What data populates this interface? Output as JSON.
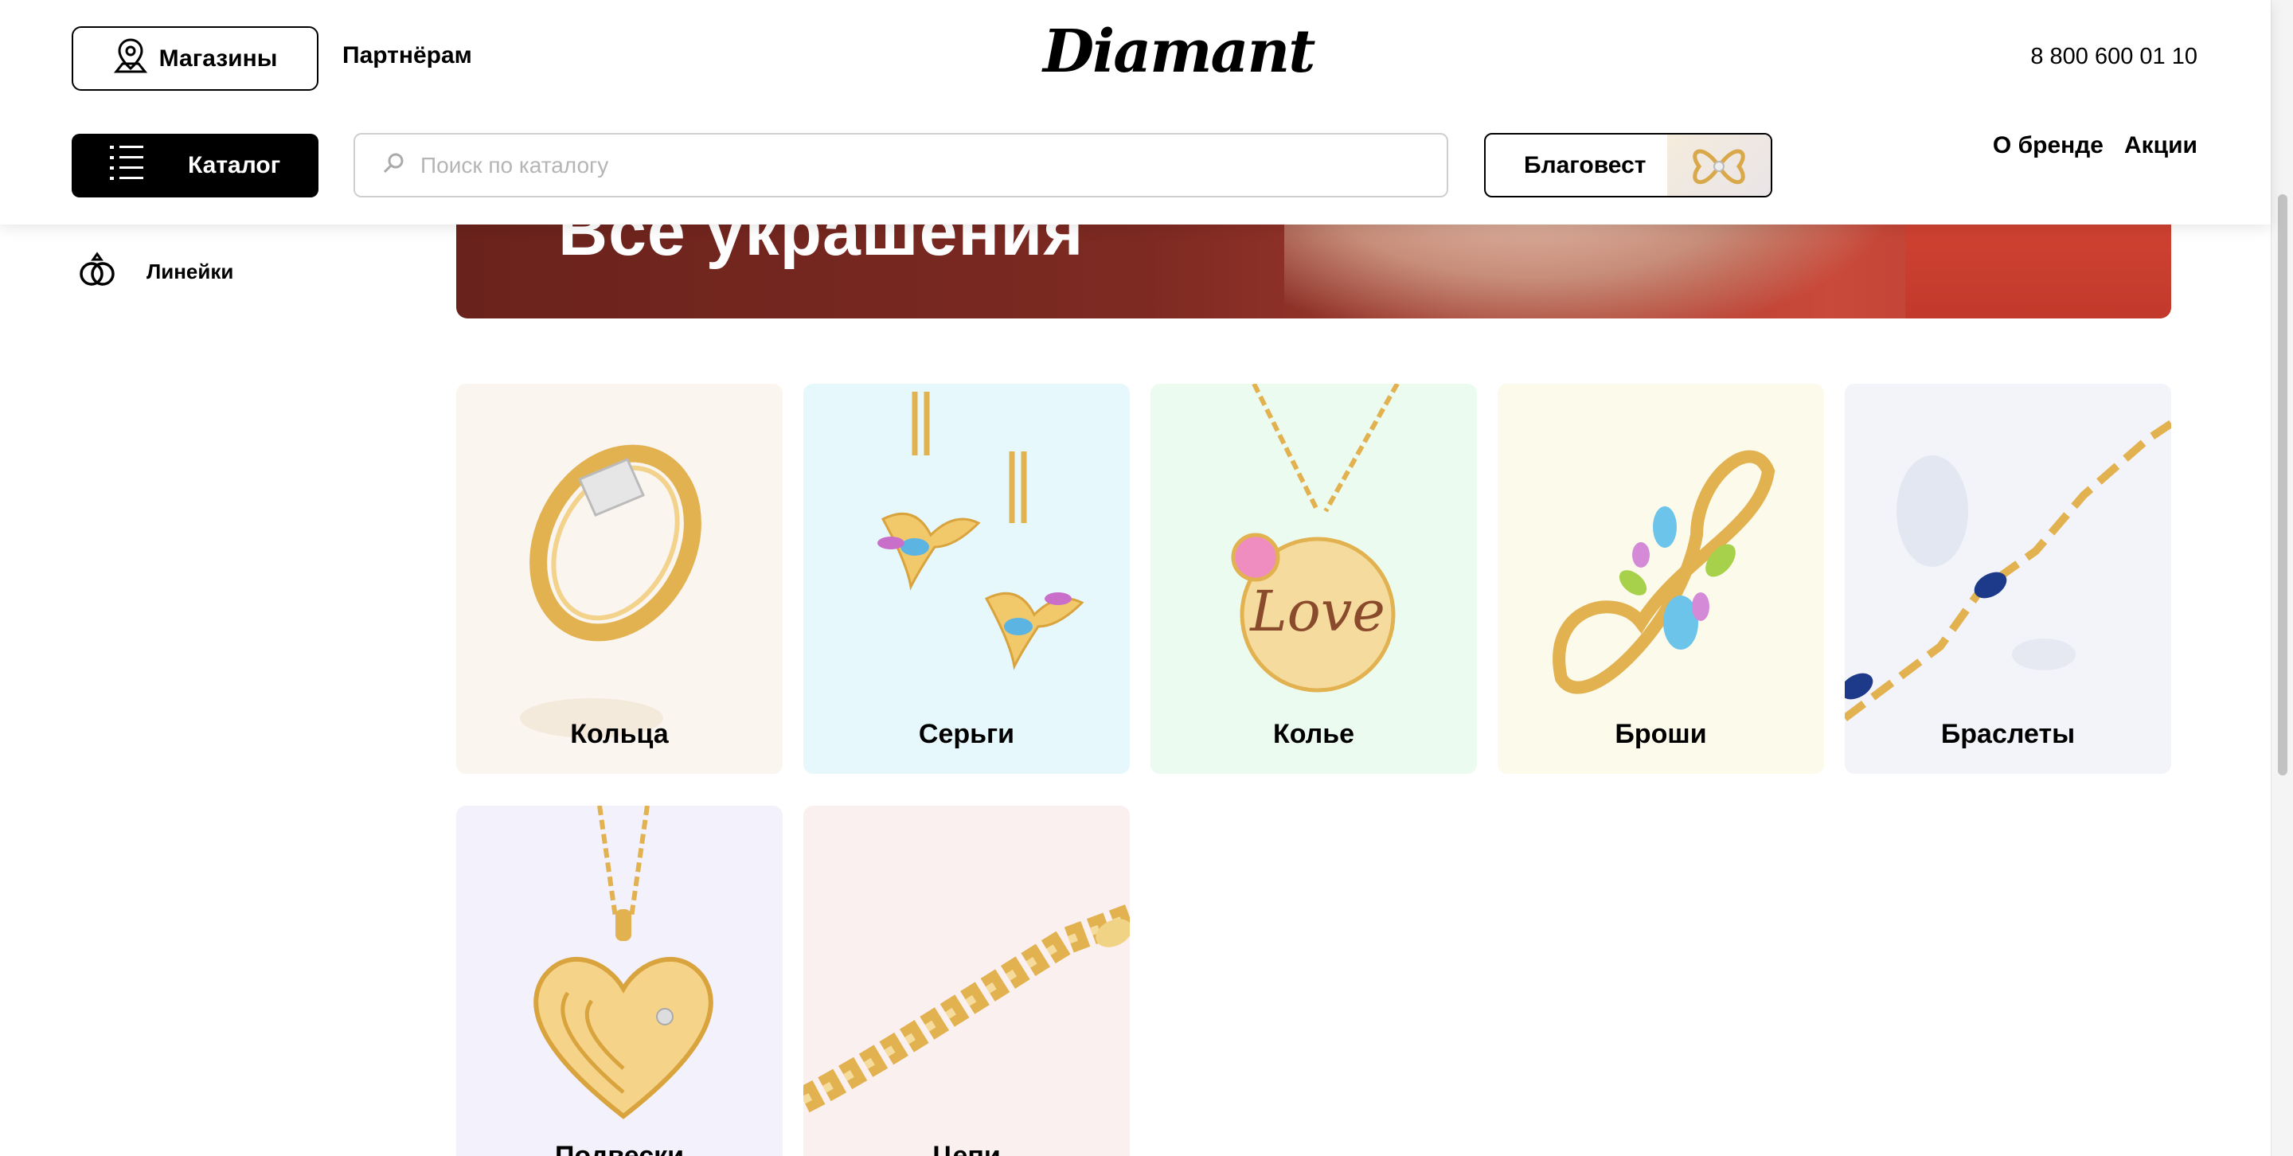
{
  "header": {
    "stores_label": "Магазины",
    "partners_label": "Партнёрам",
    "logo_text": "Diamant",
    "phone": "8 800 600 01 10",
    "catalog_label": "Каталог",
    "search_placeholder": "Поиск по каталогу",
    "blagovest_label": "Благовест",
    "nav": [
      "О бренде",
      "Акции"
    ]
  },
  "sidebar": {
    "items": [
      {
        "label": "Линейки",
        "icon": "rings-icon"
      }
    ]
  },
  "banner": {
    "title": "Все украшения"
  },
  "categories": [
    {
      "label": "Кольца",
      "bg": "#fbf5ef",
      "icon": "ring-image"
    },
    {
      "label": "Серьги",
      "bg": "#e6f8fb",
      "icon": "earrings-image"
    },
    {
      "label": "Колье",
      "bg": "#ecfbf0",
      "icon": "necklace-image"
    },
    {
      "label": "Броши",
      "bg": "#fcfaea",
      "icon": "brooch-image"
    },
    {
      "label": "Браслеты",
      "bg": "#f3f4f9",
      "icon": "bracelet-image"
    },
    {
      "label": "Подвески",
      "bg": "#f3f2fc",
      "icon": "pendant-image"
    },
    {
      "label": "Цепи",
      "bg": "#fbf0f0",
      "icon": "chain-image"
    }
  ],
  "colors": {
    "accent": "#000000",
    "banner": "#7a2a22",
    "gold": "#e2b250"
  }
}
